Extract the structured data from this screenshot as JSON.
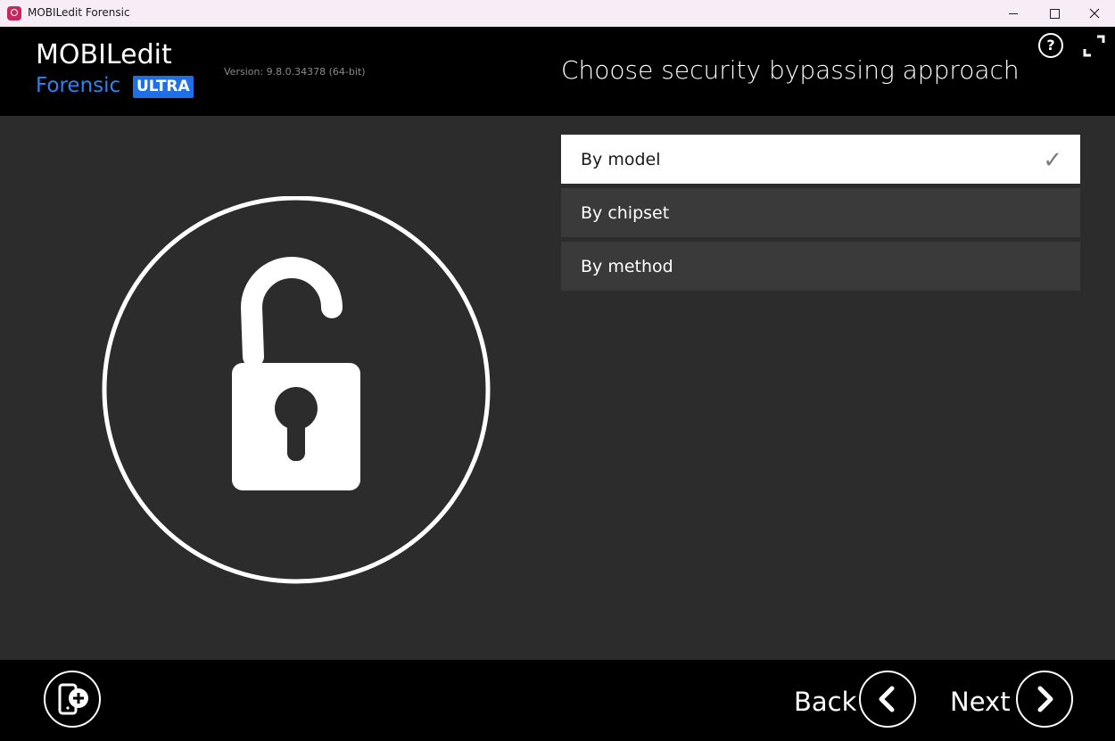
{
  "window": {
    "title": "MOBILedit Forensic"
  },
  "header": {
    "logo_top": "MOBILedit",
    "logo_bottom": "Forensic",
    "logo_badge": "ULTRA",
    "version": "Version: 9.8.0.34378 (64-bit)",
    "page_title": "Choose security bypassing approach",
    "help_symbol": "?"
  },
  "options": [
    {
      "label": "By model",
      "selected": true,
      "check_symbol": "✓"
    },
    {
      "label": "By chipset",
      "selected": false
    },
    {
      "label": "By method",
      "selected": false
    }
  ],
  "footer": {
    "back_label": "Back",
    "next_label": "Next"
  },
  "icons": {
    "hero": "unlocked-padlock-icon",
    "add_device": "add-phone-icon",
    "back": "chevron-left-icon",
    "next": "chevron-right-icon",
    "help": "help-icon",
    "fullscreen": "fullscreen-icon"
  },
  "colors": {
    "header_bg": "#000000",
    "panel_bg": "#2c2c2c",
    "option_bg": "#3a3a3a",
    "option_selected_bg": "#ffffff",
    "brand_blue": "#2d83f0"
  }
}
